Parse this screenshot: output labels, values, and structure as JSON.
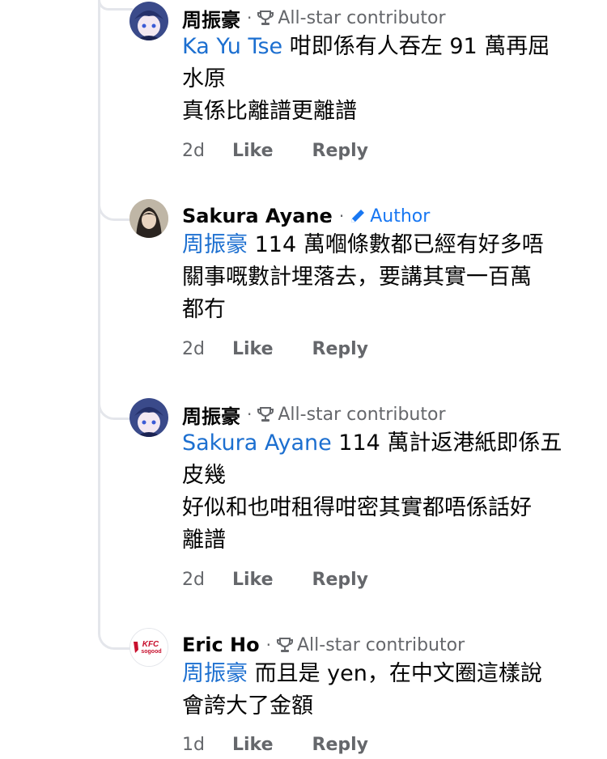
{
  "comments": [
    {
      "author": "周振豪",
      "badge": "All-star contributor",
      "badge_icon": "trophy-icon",
      "mention": "Ka Yu Tse",
      "line1_rest": " 咁即係有人吞左 91 萬再屈",
      "line2": "水原",
      "line3": "真係比離譜更離譜",
      "time": "2d",
      "like": "Like",
      "reply": "Reply"
    },
    {
      "author": "Sakura Ayane",
      "badge": "Author",
      "badge_icon": "pencil-icon",
      "mention": "周振豪",
      "line1_rest": " 114 萬嗰條數都已經有好多唔",
      "line2": "關事嘅數計埋落去，要講其實一百萬",
      "line3": "都冇",
      "time": "2d",
      "like": "Like",
      "reply": "Reply"
    },
    {
      "author": "周振豪",
      "badge": "All-star contributor",
      "badge_icon": "trophy-icon",
      "mention": "Sakura Ayane",
      "line1_rest": " 114 萬計返港紙即係五",
      "line2": "皮幾",
      "line3": "好似和也咁租得咁密其實都唔係話好",
      "line4": "離譜",
      "time": "2d",
      "like": "Like",
      "reply": "Reply"
    },
    {
      "author": "Eric Ho",
      "badge": "All-star contributor",
      "badge_icon": "trophy-icon",
      "avatar_text_top": "KFC",
      "avatar_text_bottom": "sogood",
      "mention": "周振豪",
      "line1_rest": " 而且是 yen，在中文圈這樣說",
      "line2": "會誇大了金額",
      "time": "1d",
      "like": "Like",
      "reply": "Reply"
    }
  ],
  "colors": {
    "mention": "#1c6fd0",
    "author_badge": "#1877f2",
    "meta_gray": "#65676b",
    "thread_line": "#e4e6eb"
  }
}
